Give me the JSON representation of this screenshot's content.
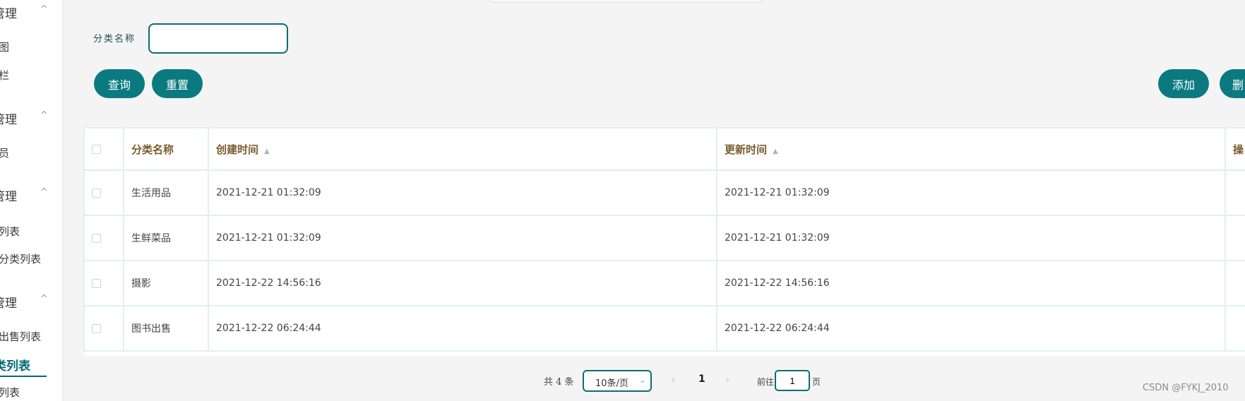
{
  "sidebar": {
    "groups": [
      {
        "label": "管理",
        "chevron": "^"
      },
      {
        "label": "管理",
        "chevron": "^"
      },
      {
        "label": "管理",
        "chevron": "^"
      },
      {
        "label": "管理",
        "chevron": "^"
      }
    ],
    "items": [
      "图",
      "栏",
      "员",
      "列表",
      "分类列表",
      "出售列表",
      "类列表",
      "列表"
    ]
  },
  "search": {
    "label": "分类名称",
    "value": "",
    "placeholder": ""
  },
  "buttons": {
    "query": "查询",
    "reset": "重置",
    "add": "添加",
    "delete": "删"
  },
  "table": {
    "columns": [
      "分类名称",
      "创建时间",
      "更新时间",
      "操"
    ],
    "rows": [
      {
        "name": "生活用品",
        "created": "2021-12-21 01:32:09",
        "updated": "2021-12-21 01:32:09"
      },
      {
        "name": "生鲜菜品",
        "created": "2021-12-21 01:32:09",
        "updated": "2021-12-21 01:32:09"
      },
      {
        "name": "摄影",
        "created": "2021-12-22 14:56:16",
        "updated": "2021-12-22 14:56:16"
      },
      {
        "name": "图书出售",
        "created": "2021-12-22 06:24:44",
        "updated": "2021-12-22 06:24:44"
      }
    ]
  },
  "pagination": {
    "total": "共 4 条",
    "page_size": "10条/页",
    "prev": "‹",
    "current": "1",
    "next": "›",
    "goto_label": "前往",
    "goto_value": "1",
    "page_label": "页"
  },
  "watermark": "CSDN @FYKJ_2010",
  "colors": {
    "accent": "#0b7a80",
    "header_text": "#7a5c2e",
    "border": "#dff0f3"
  },
  "icons": [
    "chevron-up-icon",
    "checkbox-icon",
    "sort-icon",
    "chevron-left-icon",
    "chevron-right-icon",
    "dropdown-caret-icon"
  ]
}
